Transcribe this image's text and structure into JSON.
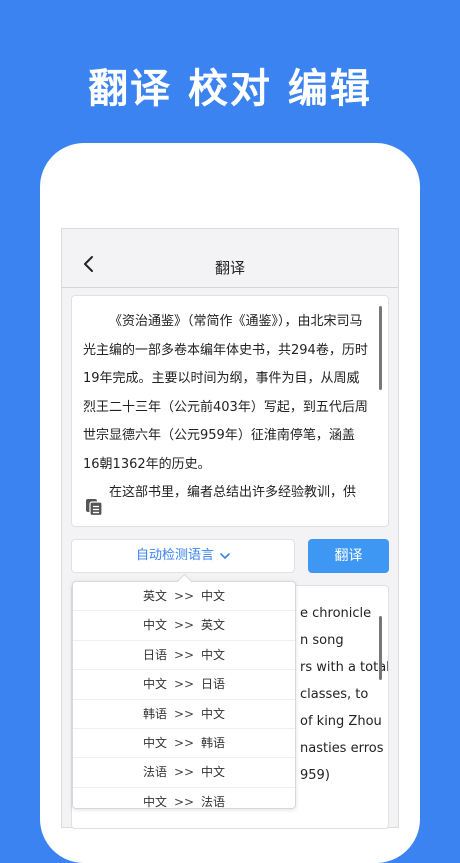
{
  "banner": {
    "headline": "翻译 校对 编辑"
  },
  "nav": {
    "title": "翻译"
  },
  "source": {
    "paragraphs": [
      "《资治通鉴》（常简作《通鉴》），由北宋司马光主编的一部多卷本编年体史书，共294卷，历时19年完成。主要以时间为纲，事件为目，从周威烈王二十三年（公元前403年）写起，到五代后周世宗显德六年（公元959年）征淮南停笔，涵盖16朝1362年的历史。",
      "在这部书里，编者总结出许多经验教训，供"
    ]
  },
  "controls": {
    "language_select": "自动检测语言",
    "translate_button": "翻译"
  },
  "result": {
    "lines": [
      "e chronicle",
      "n song",
      "rs with a total",
      "classes, to",
      "of king Zhou",
      "nasties erros",
      "959)"
    ]
  },
  "dropdown": {
    "separator": ">>",
    "options": [
      {
        "from": "英文",
        "to": "中文"
      },
      {
        "from": "中文",
        "to": "英文"
      },
      {
        "from": "日语",
        "to": "中文"
      },
      {
        "from": "中文",
        "to": "日语"
      },
      {
        "from": "韩语",
        "to": "中文"
      },
      {
        "from": "中文",
        "to": "韩语"
      },
      {
        "from": "法语",
        "to": "中文"
      },
      {
        "from": "中文",
        "to": "法语"
      }
    ]
  },
  "colors": {
    "brand_blue": "#3a83f0",
    "button_blue": "#3f97f4"
  }
}
